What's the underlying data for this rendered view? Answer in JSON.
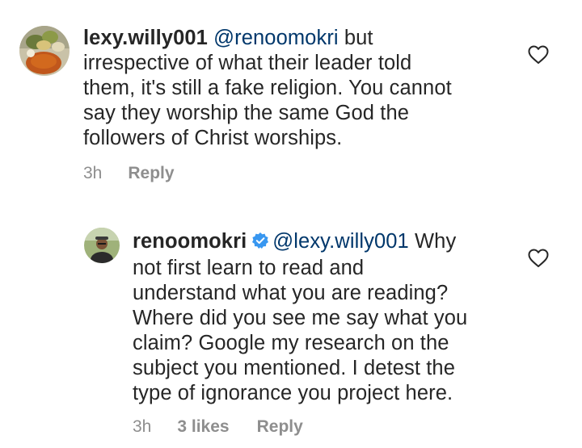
{
  "comments": [
    {
      "username": "lexy.willy001",
      "mention": "@renoomokri",
      "text_first": " but",
      "text_lines": [
        "irrespective of what their leader told",
        "them, it's still a fake religion. You cannot",
        "say they worship the same God the",
        "followers of Christ worships."
      ],
      "time": "3h",
      "reply_label": "Reply",
      "icons": {
        "avatar": "avatar-food",
        "like": "heart-outline-icon"
      }
    },
    {
      "username": "renoomokri",
      "verified": true,
      "mention": "@lexy.willy001",
      "text_first": " Why",
      "text_lines": [
        "not first learn to read and",
        "understand what you are reading?",
        "Where did you see me say what you",
        "claim? Google my research on the",
        "subject you mentioned. I detest the",
        "type of ignorance you project here."
      ],
      "time": "3h",
      "likes": "3 likes",
      "reply_label": "Reply",
      "icons": {
        "avatar": "avatar-person",
        "verified": "verified-badge-icon",
        "like": "heart-outline-icon"
      }
    }
  ],
  "colors": {
    "text": "#262626",
    "mention": "#00376b",
    "meta": "#8e8e8e",
    "verified": "#3897f0"
  }
}
